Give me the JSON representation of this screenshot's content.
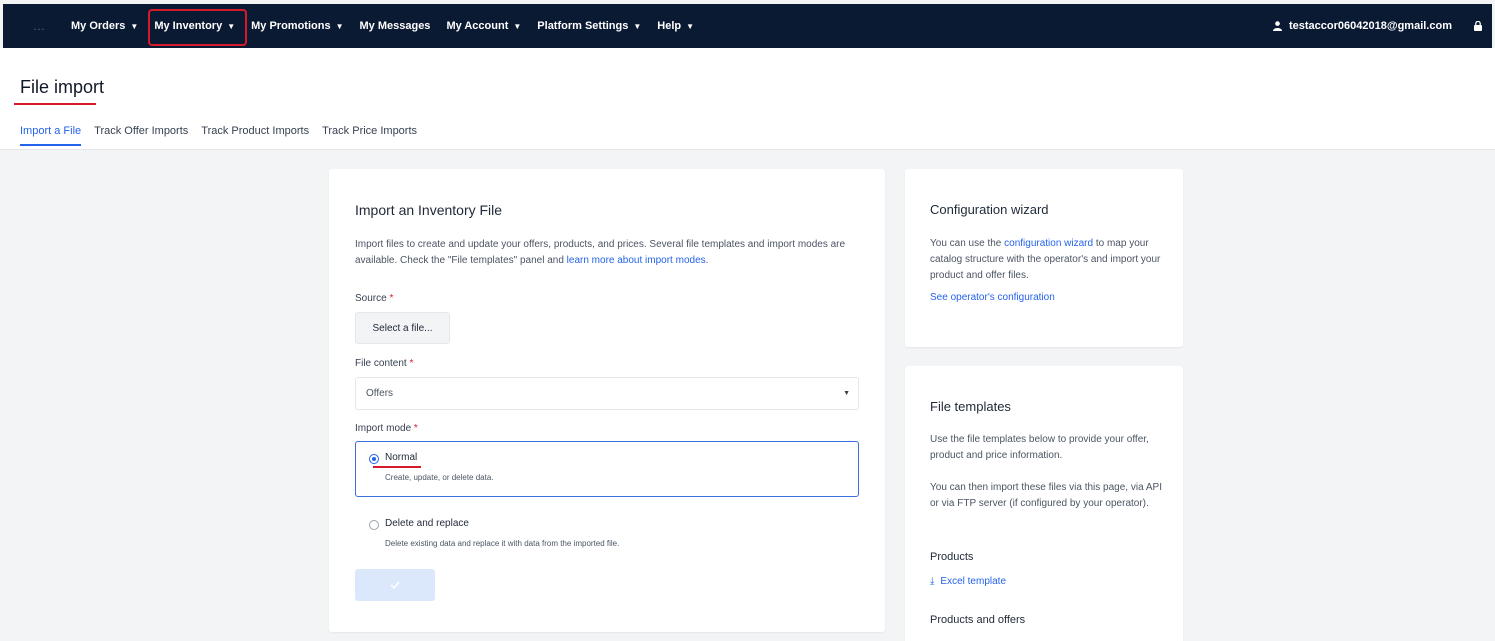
{
  "nav": {
    "items": [
      {
        "label": "My Orders",
        "caret": true
      },
      {
        "label": "My Inventory",
        "caret": true
      },
      {
        "label": "My Promotions",
        "caret": true
      },
      {
        "label": "My Messages",
        "caret": false
      },
      {
        "label": "My Account",
        "caret": true
      },
      {
        "label": "Platform Settings",
        "caret": true
      },
      {
        "label": "Help",
        "caret": true
      }
    ],
    "user_email": "testaccor06042018@gmail.com"
  },
  "page": {
    "title": "File import",
    "tabs": [
      "Import a File",
      "Track Offer Imports",
      "Track Product Imports",
      "Track Price Imports"
    ]
  },
  "import_card": {
    "title": "Import an Inventory File",
    "desc_part1": "Import files to create and update your offers, products, and prices. Several file templates and import modes are available. Check the \"File templates\" panel and ",
    "desc_link": "learn more about import modes",
    "desc_part2": ".",
    "source_label": "Source",
    "select_file_label": "Select a file...",
    "file_content_label": "File content",
    "file_content_value": "Offers",
    "import_mode_label": "Import mode",
    "modes": [
      {
        "title": "Normal",
        "desc": "Create, update, or delete data.",
        "selected": true
      },
      {
        "title": "Delete and replace",
        "desc": "Delete existing data and replace it with data from the imported file.",
        "selected": false
      }
    ],
    "required_mark": "*"
  },
  "wizard_card": {
    "title": "Configuration wizard",
    "text_part1": "You can use the ",
    "text_link": "configuration wizard",
    "text_part2": " to map your catalog structure with the operator's and import your product and offer files.",
    "operator_link": "See operator's configuration"
  },
  "templates_card": {
    "title": "File templates",
    "text1": "Use the file templates below to provide your offer, product and price information.",
    "text2": "You can then import these files via this page, via API or via FTP server (if configured by your operator).",
    "products_label": "Products",
    "excel_template_label": "Excel template",
    "products_offers_label": "Products and offers"
  },
  "colors": {
    "nav_bg": "#0b1a33",
    "accent": "#2563eb",
    "annotation_red": "#d61a2b"
  }
}
